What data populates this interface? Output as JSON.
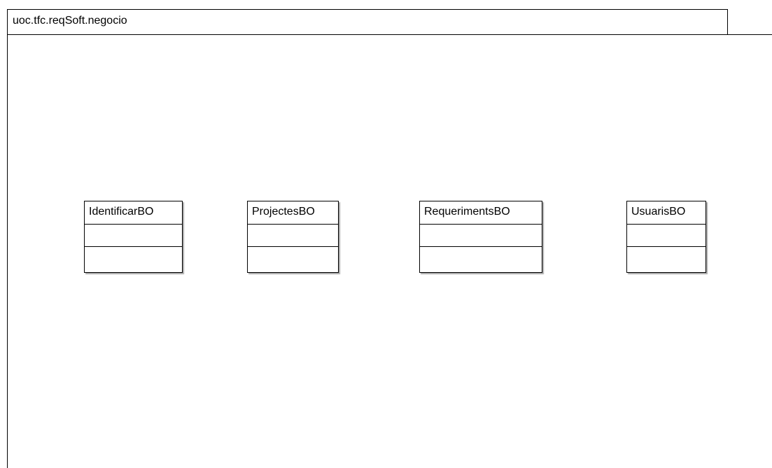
{
  "package": {
    "name": "uoc.tfc.reqSoft.negocio"
  },
  "classes": [
    {
      "name": "IdentificarBO",
      "attributes": [],
      "operations": []
    },
    {
      "name": "ProjectesBO",
      "attributes": [],
      "operations": []
    },
    {
      "name": "RequerimentsBO",
      "attributes": [],
      "operations": []
    },
    {
      "name": "UsuarisBO",
      "attributes": [],
      "operations": []
    }
  ]
}
